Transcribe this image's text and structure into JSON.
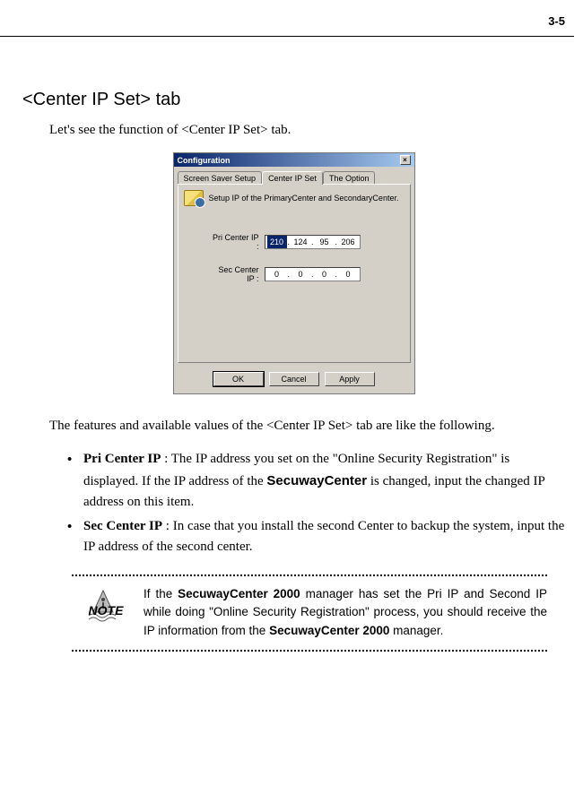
{
  "page_number": "3-5",
  "section_title": "<Center IP Set> tab",
  "intro": "Let's see the function of <Center IP Set> tab.",
  "dialog": {
    "title": "Configuration",
    "tabs": [
      "Screen Saver Setup",
      "Center IP Set",
      "The Option"
    ],
    "active_tab_index": 1,
    "tab_heading": "Setup IP of the PrimaryCenter and SecondaryCenter.",
    "rows": [
      {
        "label": "Pri Center IP :",
        "octets": [
          "210",
          "124",
          "95",
          "206"
        ],
        "selected_octet": 0
      },
      {
        "label": "Sec Center IP :",
        "octets": [
          "0",
          "0",
          "0",
          "0"
        ],
        "selected_octet": -1
      }
    ],
    "buttons": {
      "ok": "OK",
      "cancel": "Cancel",
      "apply": "Apply"
    }
  },
  "features_intro": "The features and available values of the <Center IP Set> tab are like the following.",
  "bullets": [
    {
      "term": "Pri Center IP",
      "text_before": " : The IP address you set on the \"Online Security Registration\" is displayed. If the IP address of the ",
      "strong": "SecuwayCenter",
      "text_after": " is changed, input the changed IP address on this item."
    },
    {
      "term": "Sec Center IP",
      "text_before": " : In case that you install the second Center to backup the system, input the IP address of the second center.",
      "strong": "",
      "text_after": ""
    }
  ],
  "note": {
    "label": "NOTE",
    "t1": "If the ",
    "s1": "SecuwayCenter 2000",
    "t2": " manager has set the Pri IP and Second IP while doing \"Online Security Registration\" process, you should receive the IP information from the ",
    "s2": "SecuwayCenter 2000",
    "t3": " manager."
  }
}
